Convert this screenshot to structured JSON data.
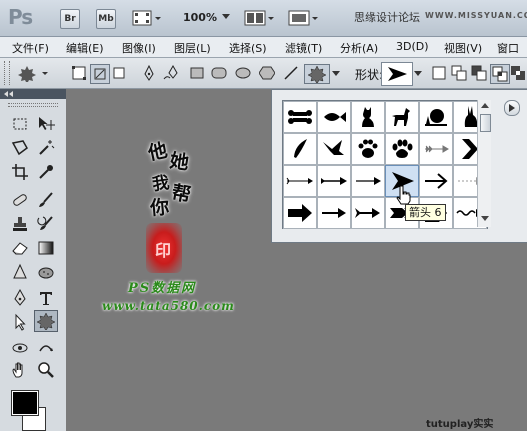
{
  "title_bar": {
    "logo": "Ps",
    "buttons": [
      "Br",
      "Mb"
    ],
    "zoom": "100%",
    "site_text": "思缘设计论坛",
    "site_url": "WWW.MISSYUAN.COM"
  },
  "menu": [
    "文件(F)",
    "编辑(E)",
    "图像(I)",
    "图层(L)",
    "选择(S)",
    "滤镜(T)",
    "分析(A)",
    "3D(D)",
    "视图(V)",
    "窗口"
  ],
  "options_bar": {
    "shape_label": "形状:"
  },
  "shape_picker": {
    "tooltip": "箭头 6",
    "shapes": [
      [
        "bone-icon",
        "fish-icon",
        "cat-icon",
        "dog-icon",
        "snail-icon",
        "rabbit-icon"
      ],
      [
        "feather-icon",
        "bird-icon",
        "paw-icon",
        "dog-paw-icon",
        "arrow-feather-icon",
        "chevron-arrow-icon"
      ],
      [
        "thin-arrow-icon",
        "tailed-arrow-icon",
        "arrow-icon",
        "arrow-6-icon",
        "outline-arrow-icon",
        "dotted-arrow-icon"
      ],
      [
        "block-arrow-icon",
        "slim-arrow-icon",
        "fletched-arrow-icon",
        "double-arrow-icon",
        "pentagon-arrow-icon",
        "wave-arrow-icon"
      ]
    ]
  },
  "artwork": {
    "characters": [
      "他",
      "她",
      "我",
      "帮",
      "你"
    ],
    "seal": "印",
    "caption": "PS数据网",
    "url": "www.tata580.com",
    "watermark": "tutuplay实实"
  },
  "colors": {
    "foreground": "#000000",
    "background": "#ffffff",
    "seal_red": "#d62828",
    "caption_green": "#2a8a1a"
  }
}
